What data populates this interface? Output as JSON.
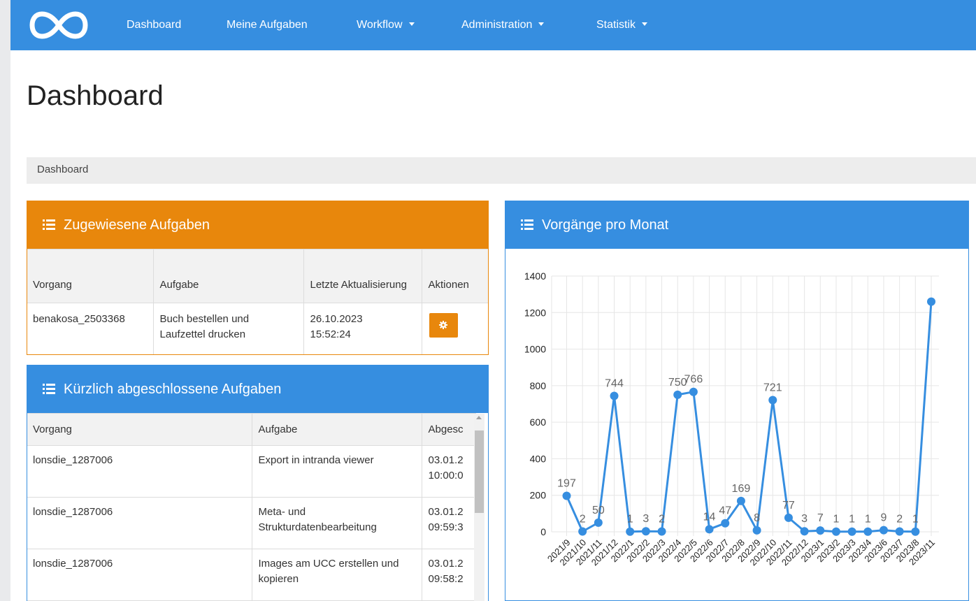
{
  "navbar": {
    "logo": "infinity-logo-icon",
    "items": [
      {
        "label": "Dashboard",
        "has_dropdown": false
      },
      {
        "label": "Meine Aufgaben",
        "has_dropdown": false
      },
      {
        "label": "Workflow",
        "has_dropdown": true
      },
      {
        "label": "Administration",
        "has_dropdown": true
      },
      {
        "label": "Statistik",
        "has_dropdown": true
      }
    ]
  },
  "page": {
    "title": "Dashboard",
    "breadcrumb": "Dashboard"
  },
  "assigned_tasks": {
    "title": "Zugewiesene Aufgaben",
    "columns": [
      "Vorgang",
      "Aufgabe",
      "Letzte Aktualisierung",
      "Aktionen"
    ],
    "rows": [
      {
        "vorgang": "benakosa_2503368",
        "aufgabe": "Buch bestellen und Laufzettel drucken",
        "date": "26.10.2023",
        "time": "15:52:24",
        "action_icon": "gear-icon"
      }
    ]
  },
  "completed_tasks": {
    "title": "Kürzlich abgeschlossene Aufgaben",
    "columns": [
      "Vorgang",
      "Aufgabe",
      "Abgesc"
    ],
    "rows": [
      {
        "vorgang": "lonsdie_1287006",
        "aufgabe": "Export in intranda viewer",
        "date": "03.01.2",
        "time": "10:00:0"
      },
      {
        "vorgang": "lonsdie_1287006",
        "aufgabe": "Meta- und Strukturdatenbearbeitung",
        "date": "03.01.2",
        "time": "09:59:3"
      },
      {
        "vorgang": "lonsdie_1287006",
        "aufgabe": "Images am UCC erstellen und kopieren",
        "date": "03.01.2",
        "time": "09:58:2"
      }
    ]
  },
  "chart_panel": {
    "title": "Vorgänge pro Monat"
  },
  "colors": {
    "primary": "#368ee0",
    "warning": "#e8870c"
  },
  "chart_data": {
    "type": "line",
    "title": "",
    "xlabel": "",
    "ylabel": "",
    "ylim": [
      0,
      1400
    ],
    "yticks": [
      0,
      200,
      400,
      600,
      800,
      1000,
      1200,
      1400
    ],
    "grid": true,
    "x": [
      "2021/9",
      "2021/10",
      "2021/11",
      "2021/12",
      "2022/1",
      "2022/2",
      "2022/3",
      "2022/4",
      "2022/5",
      "2022/6",
      "2022/7",
      "2022/8",
      "2022/9",
      "2022/10",
      "2022/11",
      "2022/12",
      "2023/1",
      "2023/2",
      "2023/3",
      "2023/4",
      "2023/6",
      "2023/7",
      "2023/8",
      "2023/11"
    ],
    "y": [
      197,
      2,
      50,
      744,
      1,
      3,
      2,
      750,
      766,
      14,
      47,
      169,
      8,
      721,
      77,
      3,
      7,
      1,
      1,
      1,
      9,
      2,
      1,
      1260
    ],
    "data_labels": [
      "197",
      "2",
      "50",
      "744",
      "1",
      "3",
      "2",
      "750",
      "766",
      "14",
      "47",
      "169",
      "8",
      "721",
      "77",
      "3",
      "7",
      "1",
      "1",
      "1",
      "9",
      "2",
      "1",
      ""
    ],
    "line_color": "#368ee0"
  }
}
